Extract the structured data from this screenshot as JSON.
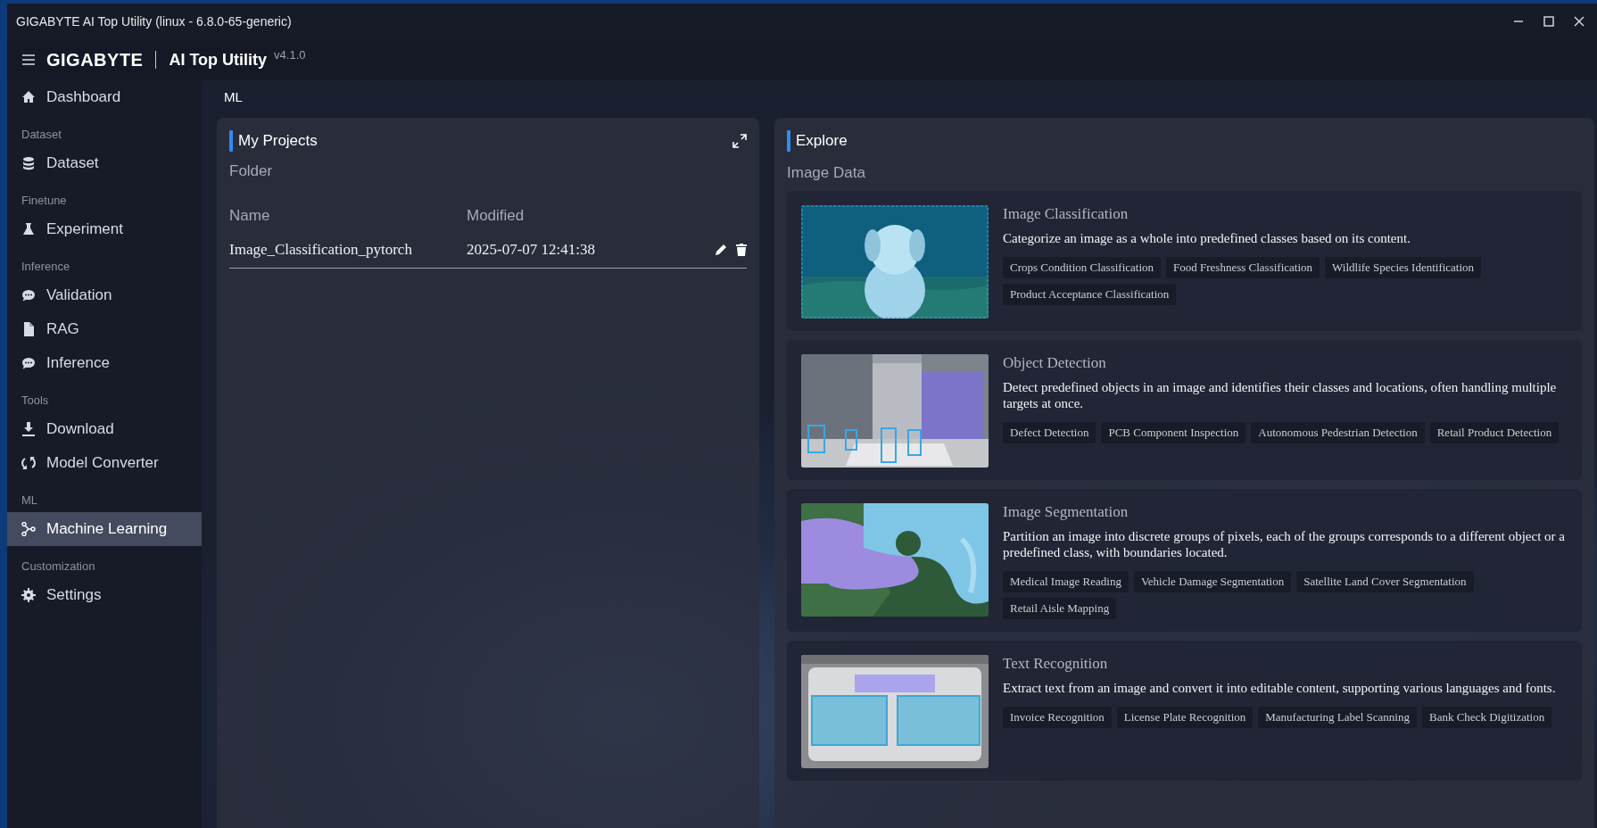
{
  "window": {
    "title": "GIGABYTE AI Top Utility (linux - 6.8.0-65-generic)"
  },
  "header": {
    "brand": "GIGABYTE",
    "app_name": "AI Top Utility",
    "version": "v4.1.0"
  },
  "sidebar": {
    "items": [
      {
        "kind": "item",
        "label": "Dashboard",
        "selected": false
      },
      {
        "kind": "section",
        "label": "Dataset"
      },
      {
        "kind": "item",
        "label": "Dataset",
        "selected": false
      },
      {
        "kind": "section",
        "label": "Finetune"
      },
      {
        "kind": "item",
        "label": "Experiment",
        "selected": false
      },
      {
        "kind": "section",
        "label": "Inference"
      },
      {
        "kind": "item",
        "label": "Validation",
        "selected": false
      },
      {
        "kind": "item",
        "label": "RAG",
        "selected": false
      },
      {
        "kind": "item",
        "label": "Inference",
        "selected": false
      },
      {
        "kind": "section",
        "label": "Tools"
      },
      {
        "kind": "item",
        "label": "Download",
        "selected": false
      },
      {
        "kind": "item",
        "label": "Model Converter",
        "selected": false
      },
      {
        "kind": "section",
        "label": "ML"
      },
      {
        "kind": "item",
        "label": "Machine Learning",
        "selected": true
      },
      {
        "kind": "section",
        "label": "Customization"
      },
      {
        "kind": "item",
        "label": "Settings",
        "selected": false
      }
    ]
  },
  "breadcrumb": "ML",
  "projects": {
    "title": "My Projects",
    "folder": "Folder",
    "columns": [
      "Name",
      "Modified"
    ],
    "rows": [
      {
        "name": "Image_Classification_pytorch",
        "modified": "2025-07-07 12:41:38"
      }
    ]
  },
  "explore": {
    "title": "Explore",
    "section": "Image Data",
    "cards": [
      {
        "title": "Image Classification",
        "description": "Categorize an image as a whole into predefined classes based on its content.",
        "tags": [
          "Crops Condition Classification",
          "Food Freshness Classification",
          "Wildlife Species Identification",
          "Product Acceptance Classification"
        ]
      },
      {
        "title": "Object Detection",
        "description": "Detect predefined objects in an image and identifies their classes and locations, often handling multiple targets at once.",
        "tags": [
          "Defect Detection",
          "PCB Component Inspection",
          "Autonomous Pedestrian Detection",
          "Retail Product Detection"
        ]
      },
      {
        "title": "Image Segmentation",
        "description": "Partition an image into discrete groups of pixels, each of the groups corresponds to a different object or a predefined class, with boundaries located.",
        "tags": [
          "Medical Image Reading",
          "Vehicle Damage Segmentation",
          "Satellite Land Cover Segmentation",
          "Retail Aisle Mapping"
        ]
      },
      {
        "title": "Text Recognition",
        "description": "Extract text from an image and convert it into editable content, supporting various languages and fonts.",
        "tags": [
          "Invoice Recognition",
          "License Plate Recognition",
          "Manufacturing Label Scanning",
          "Bank Check Digitization"
        ]
      }
    ]
  }
}
